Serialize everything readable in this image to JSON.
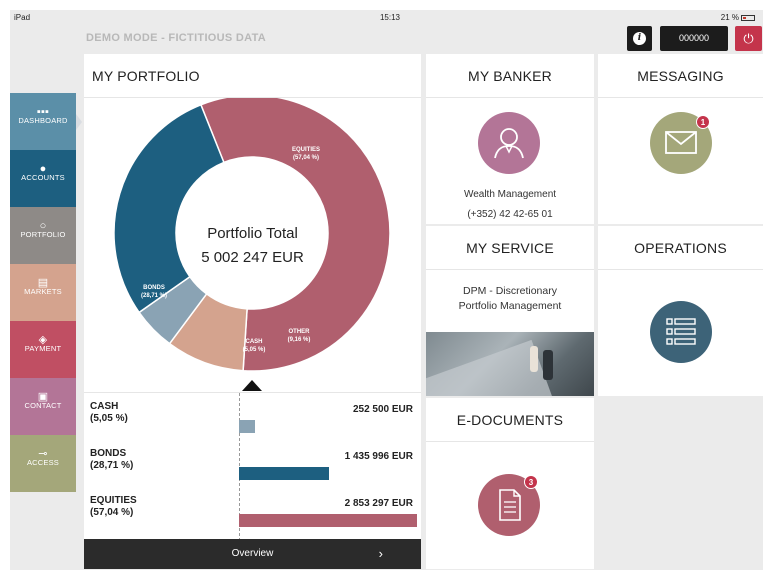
{
  "status_bar": {
    "device": "iPad",
    "time": "15:13",
    "battery": "21 %"
  },
  "header": {
    "demo_mode": "DEMO MODE - FICTITIOUS DATA",
    "info_icon": "info-icon",
    "user_code": "000000",
    "power_icon": "power-icon"
  },
  "sidebar": {
    "items": [
      {
        "label": "DASHBOARD",
        "icon": "grid-icon",
        "glyph": "▪▪▪",
        "color": "#5b8fa8"
      },
      {
        "label": "ACCOUNTS",
        "icon": "globe-icon",
        "glyph": "●",
        "color": "#1d5f80"
      },
      {
        "label": "PORTFOLIO",
        "icon": "ring-icon",
        "glyph": "○",
        "color": "#8e8a87"
      },
      {
        "label": "MARKETS",
        "icon": "markets-icon",
        "glyph": "▤",
        "color": "#d4a38e"
      },
      {
        "label": "PAYMENT",
        "icon": "payment-icon",
        "glyph": "◈",
        "color": "#c04f63"
      },
      {
        "label": "CONTACT",
        "icon": "contact-icon",
        "glyph": "▣",
        "color": "#b37597"
      },
      {
        "label": "ACCESS",
        "icon": "key-icon",
        "glyph": "⊸",
        "color": "#a4a77a"
      }
    ]
  },
  "portfolio": {
    "title": "MY PORTFOLIO",
    "total_label": "Portfolio Total",
    "total_value": "5 002 247 EUR",
    "overview_label": "Overview",
    "colors": {
      "equities": "#b05f6e",
      "bonds": "#1d5f80",
      "cash": "#8aa3b4",
      "other": "#d4a38e"
    }
  },
  "chart_data": {
    "type": "pie",
    "slices": [
      {
        "name": "EQUITIES",
        "pct_label": "(57,04 %)",
        "value": 57.04,
        "color": "#b05f6e"
      },
      {
        "name": "OTHER",
        "pct_label": "(9,16 %)",
        "value": 9.16,
        "color": "#d4a38e"
      },
      {
        "name": "CASH",
        "pct_label": "(5,05 %)",
        "value": 5.05,
        "color": "#8aa3b4"
      },
      {
        "name": "BONDS",
        "pct_label": "(28,71 %)",
        "value": 28.71,
        "color": "#1d5f80"
      }
    ],
    "rows": [
      {
        "name": "CASH",
        "pct_label": "(5,05 %)",
        "amount": "252 500 EUR",
        "value": 252500,
        "color": "#8aa3b4"
      },
      {
        "name": "BONDS",
        "pct_label": "(28,71 %)",
        "amount": "1 435 996 EUR",
        "value": 1435996,
        "color": "#1d5f80"
      },
      {
        "name": "EQUITIES",
        "pct_label": "(57,04 %)",
        "amount": "2 853 297 EUR",
        "value": 2853297,
        "color": "#b05f6e"
      }
    ]
  },
  "banker": {
    "title": "MY BANKER",
    "name": "Wealth Management",
    "phone": "(+352) 42 42-65 01",
    "icon": "person-icon",
    "color": "#b37597"
  },
  "messaging": {
    "title": "MESSAGING",
    "badge": "1",
    "icon": "envelope-icon",
    "color": "#a4a77a"
  },
  "service": {
    "title": "MY SERVICE",
    "line1": "DPM - Discretionary",
    "line2": "Portfolio Management",
    "photo": "business-photo"
  },
  "operations": {
    "title": "OPERATIONS",
    "icon": "list-icon",
    "color": "#3d6378"
  },
  "edocuments": {
    "title": "E-DOCUMENTS",
    "badge": "3",
    "icon": "document-icon",
    "color": "#b05f6e"
  }
}
